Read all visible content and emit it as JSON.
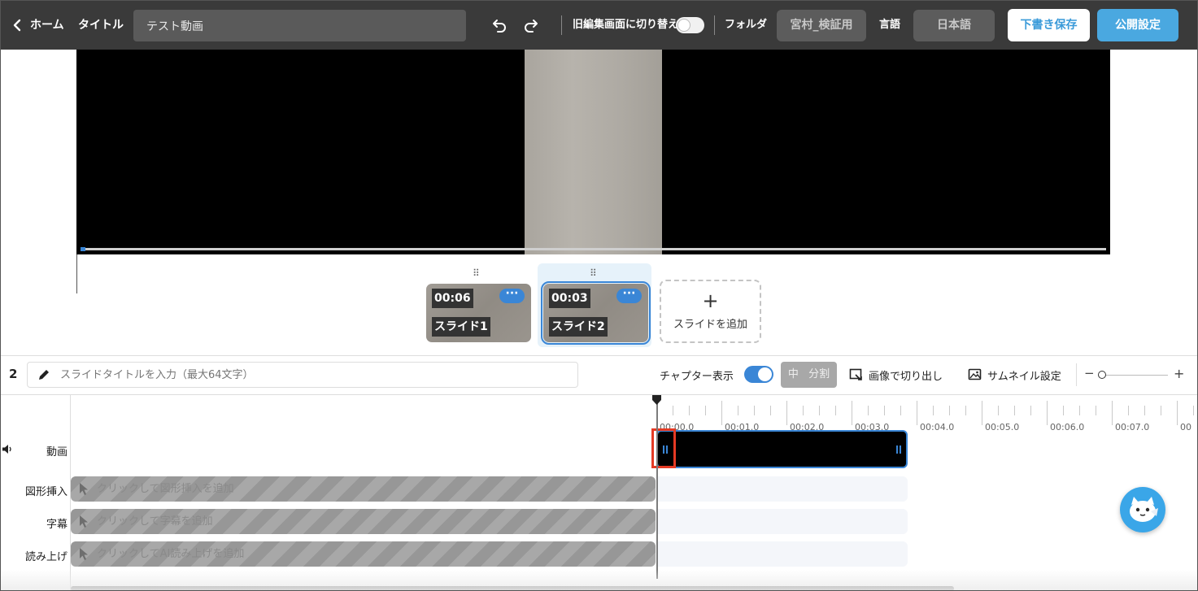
{
  "header": {
    "home_label": "ホーム",
    "title_label": "タイトル",
    "title_value": "テスト動画",
    "old_editor_label": "旧編集画面に切り替え",
    "folder_label": "フォルダ",
    "folder_value": "宮村_検証用",
    "language_label": "言語",
    "language_value": "日本語",
    "draft_save_label": "下書き保存",
    "publish_label": "公開設定"
  },
  "slides": [
    {
      "duration": "00:06",
      "name": "スライド1",
      "selected": false
    },
    {
      "duration": "00:03",
      "name": "スライド2",
      "selected": true
    }
  ],
  "add_slide_label": "スライドを追加",
  "toolbar": {
    "slide_number": "2",
    "slide_title_placeholder": "スライドタイトルを入力（最大64文字）",
    "chapter_label": "チャプター表示",
    "chapter_on": true,
    "split_icon_glyph": "中",
    "split_label": "分割",
    "crop_label": "画像で切り出し",
    "thumbnail_label": "サムネイル設定",
    "zoom_minus": "−",
    "zoom_plus": "+"
  },
  "timeline": {
    "ruler_labels": [
      "00:00.0",
      "00:01.0",
      "00:02.0",
      "00:03.0",
      "00:04.0",
      "00:05.0",
      "00:06.0",
      "00:07.0",
      "00"
    ],
    "tracks": [
      {
        "label": "動画"
      },
      {
        "label": "図形挿入",
        "hint": "クリックして図形挿入を追加"
      },
      {
        "label": "字幕",
        "hint": "クリックして字幕を追加"
      },
      {
        "label": "読み上げ",
        "hint": "クリックしてAI読み上げを追加"
      }
    ]
  },
  "colors": {
    "accent": "#3a86d6",
    "topbar": "#3a3a3a",
    "highlight": "#e53a24",
    "publish": "#4aa8e0"
  }
}
